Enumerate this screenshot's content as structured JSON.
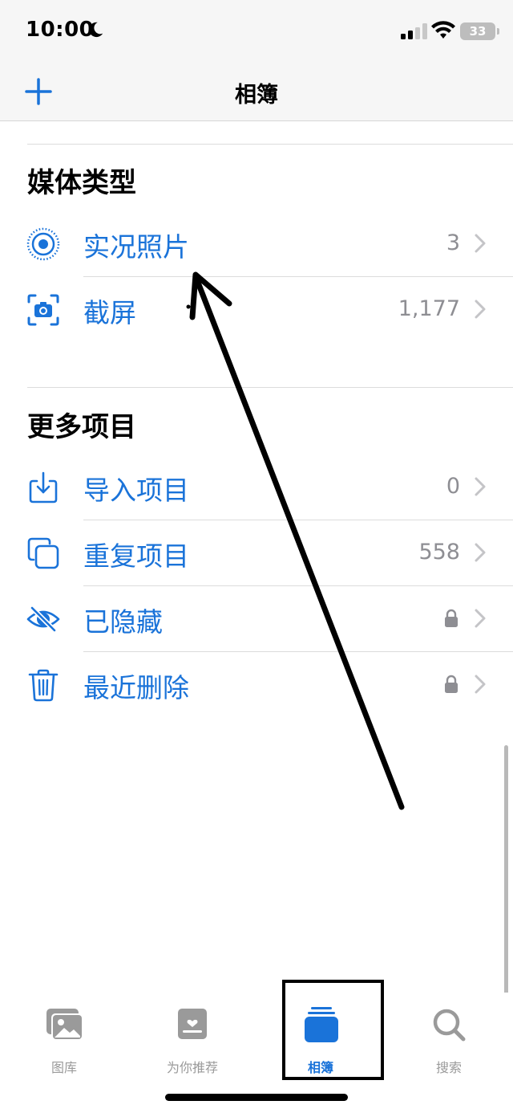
{
  "status_bar": {
    "time": "10:00",
    "battery": "33"
  },
  "nav": {
    "title": "相簿"
  },
  "sections": [
    {
      "header": "媒体类型",
      "items": [
        {
          "label": "实况照片",
          "count": "3",
          "icon": "live-photo-icon"
        },
        {
          "label": "截屏",
          "count": "1,177",
          "icon": "screenshot-icon"
        }
      ]
    },
    {
      "header": "更多项目",
      "items": [
        {
          "label": "导入项目",
          "count": "0",
          "icon": "import-icon"
        },
        {
          "label": "重复项目",
          "count": "558",
          "icon": "duplicate-icon"
        },
        {
          "label": "已隐藏",
          "locked": true,
          "icon": "hidden-eye-icon"
        },
        {
          "label": "最近删除",
          "locked": true,
          "icon": "trash-icon"
        }
      ]
    }
  ],
  "tabs": [
    {
      "label": "图库",
      "icon": "library-icon"
    },
    {
      "label": "为你推荐",
      "icon": "for-you-icon"
    },
    {
      "label": "相簿",
      "icon": "albums-icon",
      "active": true
    },
    {
      "label": "搜索",
      "icon": "search-icon"
    }
  ],
  "colors": {
    "accent": "#1a73d9",
    "secondary": "#8e8e93",
    "tab_inactive": "#9a9a9a"
  }
}
